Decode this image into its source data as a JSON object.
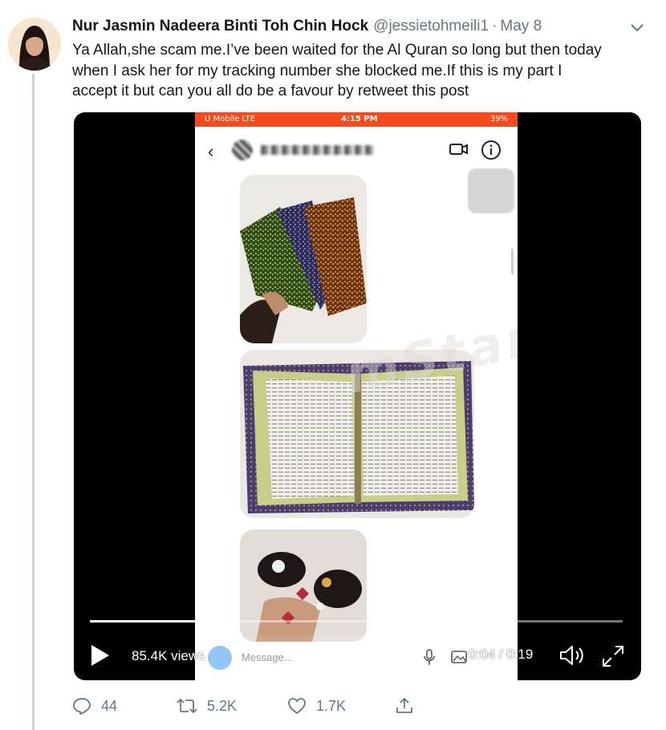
{
  "tweet": {
    "author_name": "Nur Jasmin Nadeera Binti Toh Chin Hock",
    "handle": "@jessietohmeili1",
    "separator": "·",
    "date": "May 8",
    "text_lines": [
      "Ya Allah,she scam me.I’ve been waited for the Al Quran so long but then today",
      "when I ask her for my tracking number she blocked me.If this is my part I",
      "accept it but can you all do be a favour by retweet this post"
    ]
  },
  "video": {
    "views": "85.4K views",
    "timecode": "0:04 / 0:19",
    "progress": 0.2
  },
  "phone_screen": {
    "carrier": "U Mobile  LTE",
    "time": "4:15 PM",
    "battery": "39%",
    "message_placeholder": "Message...",
    "watermark": "mStar"
  },
  "actions": {
    "replies": "44",
    "retweets": "5.2K",
    "likes": "1.7K"
  },
  "colors": {
    "status_bar": "#f44a1c",
    "muted": "#657786"
  }
}
